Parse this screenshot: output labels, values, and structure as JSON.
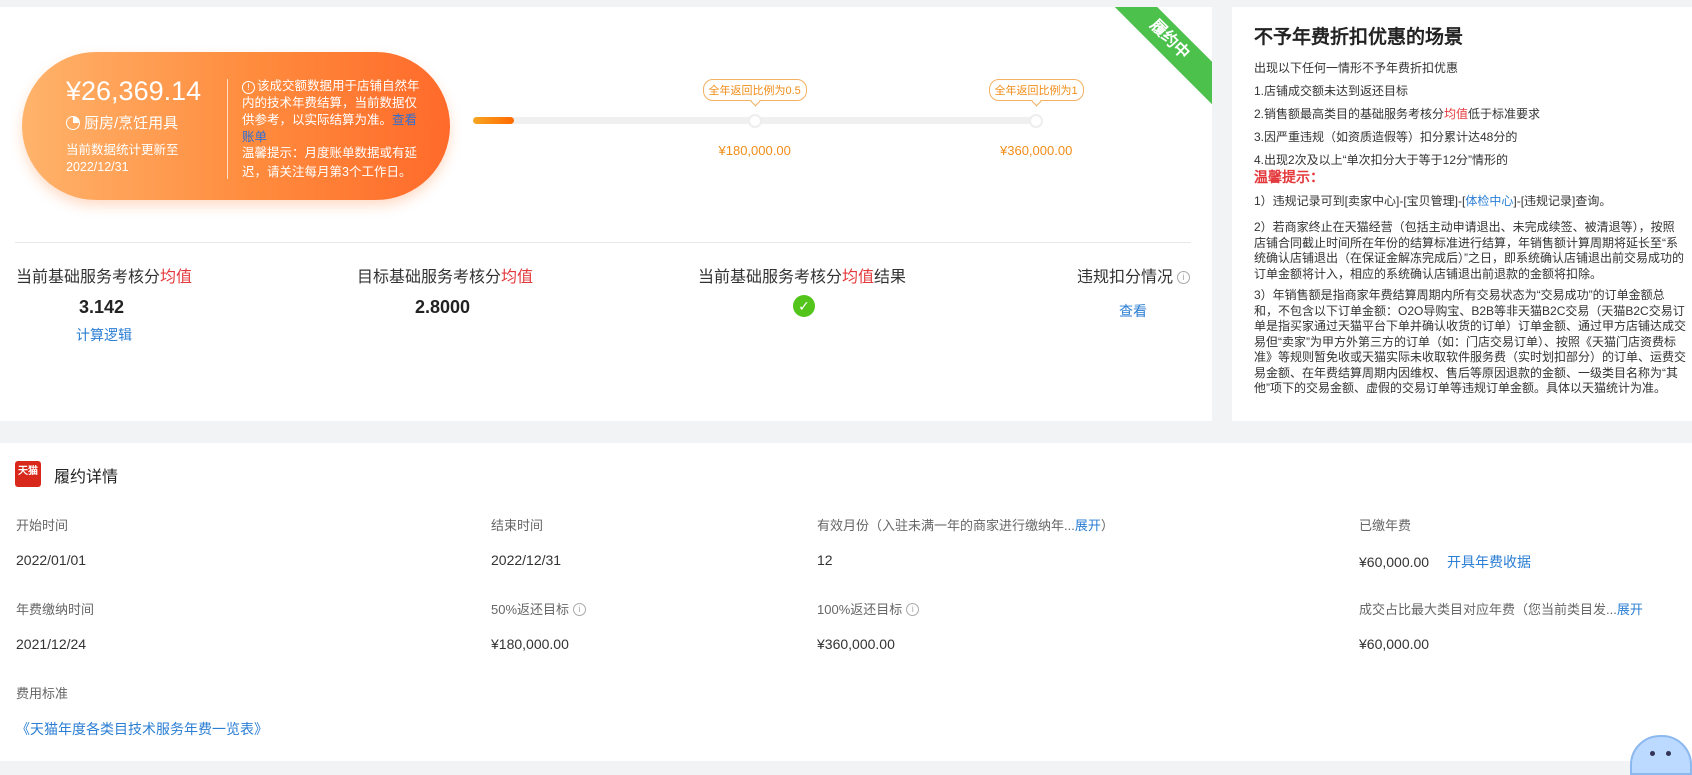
{
  "status_ribbon": "履约中",
  "summary": {
    "amount": "¥26,369.14",
    "category": "厨房/烹饪用具",
    "updated": "当前数据统计更新至2022/12/31",
    "note": "该成交额数据用于店铺自然年内的技术年费结算，当前数据仅供参考，以实际结算为准。",
    "note_link": "查看账单",
    "tip": "温馨提示：月度账单数据或有延迟，请关注每月第3个工作日。"
  },
  "progress": {
    "fraction": 0.073,
    "milestones": [
      {
        "label": "全年返回比例为0.5",
        "value": "¥180,000.00",
        "fraction": 0.5
      },
      {
        "label": "全年返回比例为1",
        "value": "¥360,000.00",
        "fraction": 1.0
      }
    ]
  },
  "metrics": {
    "current": {
      "label_a": "当前基础服务考核分",
      "label_red": "均值",
      "value": "3.142",
      "link": "计算逻辑"
    },
    "target": {
      "label_a": "目标基础服务考核分",
      "label_red": "均值",
      "value": "2.8000"
    },
    "result": {
      "label_a": "当前基础服务考核分",
      "label_red": "均值",
      "label_b": "结果"
    },
    "violation": {
      "label": "违规扣分情况",
      "link": "查看"
    }
  },
  "no_discount": {
    "title": "不予年费折扣优惠的场景",
    "intro": "出现以下任何一情形不予年费折扣优惠",
    "items": [
      {
        "text": "1.店铺成交额未达到返还目标"
      },
      {
        "a": "2.销售额最高类目的基础服务考核分",
        "red": "均值",
        "b": "低于标准要求"
      },
      {
        "text": "3.因严重违规（如资质造假等）扣分累计达48分的"
      },
      {
        "text": "4.出现2次及以上“单次扣分大于等于12分”情形的"
      }
    ],
    "warm_title": "温馨提示：",
    "p1_a": "1）违规记录可到[卖家中心]-[宝贝管理]-[",
    "p1_link": "体检中心",
    "p1_b": "]-[违规记录]查询。",
    "p2": "2）若商家终止在天猫经营（包括主动申请退出、未完成续签、被清退等），按照店铺合同截止时间所在年份的结算标准进行结算，年销售额计算周期将延长至“系统确认店铺退出（在保证金解冻完成后）”之日，即系统确认店铺退出前交易成功的订单金额将计入，相应的系统确认店铺退出前退款的金额将扣除。",
    "p3": "3）年销售额是指商家年费结算周期内所有交易状态为“交易成功”的订单金额总和，不包含以下订单金额：O2O导购宝、B2B等非天猫B2C交易（天猫B2C交易订单是指买家通过天猫平台下单并确认收货的订单）订单金额、通过甲方店铺达成交易但“卖家”为甲方外第三方的订单（如：门店交易订单）、按照《天猫门店资费标准》等规则暂免收或天猫实际未收取软件服务费（实时划扣部分）的订单、运费交易金额、在年费结算周期内因维权、售后等原因退款的金额、一级类目名称为“其他”项下的交易金额、虚假的交易订单等违规订单金额。具体以天猫统计为准。"
  },
  "details": {
    "logo_text": "天猫",
    "title": "履约详情",
    "start_label": "开始时间",
    "start_value": "2022/01/01",
    "end_label": "结束时间",
    "end_value": "2022/12/31",
    "months_label": "有效月份（入驻未满一年的商家进行缴纳年...",
    "months_expand": "展开",
    "months_close": "）",
    "months_value": "12",
    "paid_label": "已缴年费",
    "paid_value": "¥60,000.00",
    "paid_link": "开具年费收据",
    "pay_time_label": "年费缴纳时间",
    "pay_time_value": "2021/12/24",
    "target50_label": "50%返还目标",
    "target50_value": "¥180,000.00",
    "target100_label": "100%返还目标",
    "target100_value": "¥360,000.00",
    "max_cat_label": "成交占比最大类目对应年费（您当前类目发...",
    "max_cat_expand": "展开",
    "max_cat_value": "¥60,000.00",
    "standard_label": "费用标准",
    "standard_link": "《天猫年度各类目技术服务年费一览表》"
  },
  "colors": {
    "accent_orange": "#ff8b3d",
    "link_blue": "#2a7ed3",
    "ok_green": "#52c41a",
    "red": "#e4393c",
    "ribbon_green": "#4cc14c"
  }
}
